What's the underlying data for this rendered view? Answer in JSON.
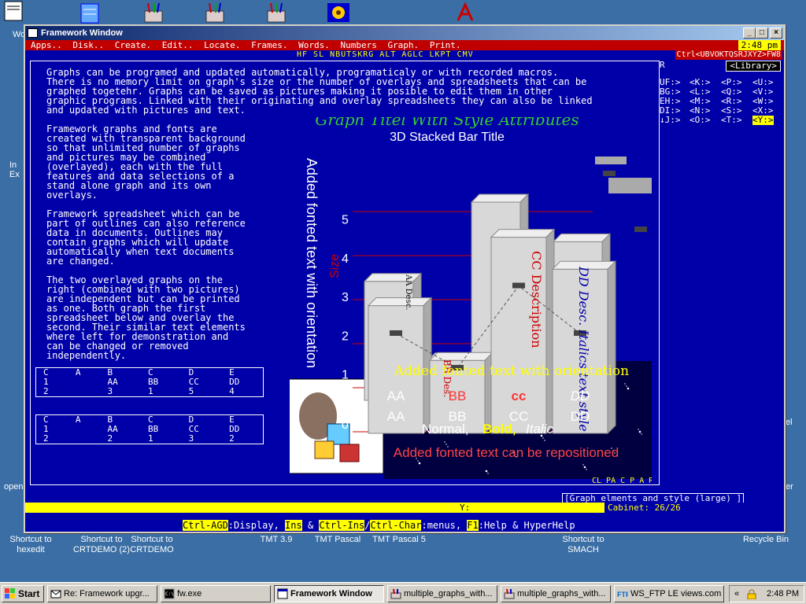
{
  "desktop": {
    "top_labels": [
      "Wo",
      "In Ex",
      "open",
      "el",
      "er"
    ],
    "icons": [
      {
        "label": "Shortcut to hexedit"
      },
      {
        "label": "Shortcut to CRTDEMO (2)"
      },
      {
        "label": "Shortcut to CRTDEMO"
      },
      {
        "label": "TMT 3.9"
      },
      {
        "label": "TMT Pascal"
      },
      {
        "label": "TMT Pascal 5"
      },
      {
        "label": "Shortcut to SMACH"
      },
      {
        "label": "Recycle Bin"
      }
    ]
  },
  "window": {
    "title": "Framework Window",
    "minimize": "_",
    "maximize": "□",
    "close": "×"
  },
  "menu": {
    "items": [
      "Apps..",
      "Disk..",
      "Create.",
      "Edit..",
      "Locate.",
      "Frames.",
      "Words.",
      "Numbers",
      "Graph.",
      "Print."
    ],
    "clock": "2:48 pm",
    "hotkeys": "HF SL NBUTSKRG ALT AGLC LKPT CMV",
    "ctrl_hint": "Ctrl<UBVOKTQSRJXYZ>FW8"
  },
  "document": {
    "para1": "Graphs can be programed and updated automatically, programaticaly or with recorded macros.\nThere is no memory limit on graph's size or the number of overlays and spreadsheets that can be\ngraphed togetehr. Graphs can be saved as pictures making it posible to edit them in other\ngraphic programs. Linked with their originating and overlay spreadsheets they can also be linked\nand updated with pictures and text.",
    "para2": "Framework graphs and fonts are\ncreated with transparent background\nso that unlimited number of graphs\nand pictures may be combined\n(overlayed), each with the full\nfeatures and data selections of a\nstand alone graph and its own\noverlays.",
    "para3": "Framework spreadsheet which can be\npart of outlines can also reference\ndata in documents. Outlines may\ncontain graphs which will update\nautomatically when text documents\nare changed.",
    "para4": "The two overlayed graphs on the\nright (combined with two pictures)\nare independent but can be printed\nas one. Both graph the first\nspreadsheet below and overlay the\nsecond. Their similar text elements\nwhere left for demonstration and\ncan be changed or removed\nindependently."
  },
  "spreadsheet1": {
    "header": [
      "C",
      "A",
      "B",
      "C",
      "D",
      "E"
    ],
    "rows": [
      [
        "1",
        "",
        "AA",
        "BB",
        "CC",
        "DD"
      ],
      [
        "2",
        "",
        "3",
        "1",
        "5",
        "4"
      ]
    ]
  },
  "spreadsheet2": {
    "header": [
      "C",
      "A",
      "B",
      "C",
      "D",
      "E"
    ],
    "rows": [
      [
        "1",
        "",
        "AA",
        "BB",
        "CC",
        "DD"
      ],
      [
        "2",
        "",
        "2",
        "1",
        "3",
        "2"
      ]
    ]
  },
  "side_panel": {
    "library": "<Library>",
    "r_label": "R",
    "keys": [
      {
        "text": "UF:>"
      },
      {
        "text": "<K:>"
      },
      {
        "text": "<P:>"
      },
      {
        "text": "<U:>"
      },
      {
        "text": "BG:>"
      },
      {
        "text": "<L:>"
      },
      {
        "text": "<Q:>"
      },
      {
        "text": "<V:>"
      },
      {
        "text": "EH:>"
      },
      {
        "text": "<M:>"
      },
      {
        "text": "<R:>"
      },
      {
        "text": "<W:>"
      },
      {
        "text": "DI:>"
      },
      {
        "text": "<N:>"
      },
      {
        "text": "<S:>"
      },
      {
        "text": "<X:>"
      },
      {
        "text": "↓J:>"
      },
      {
        "text": "<O:>"
      },
      {
        "text": "<T:>"
      },
      {
        "text": "<Y:>"
      }
    ]
  },
  "graph": {
    "styled_title": "Graph Titel With Style Attributes",
    "title": "3D Stacked Bar Title",
    "vertical_text": "Added fonted text with orientation",
    "ylabel": "Size",
    "overlay_text": "Added fonted text with orientation",
    "font_demo_normal": "Normal,",
    "font_demo_bold": "Bold,",
    "font_demo_italic": "Italic",
    "reposition_text": "Added fonted text can be repositioned",
    "bar_desc": [
      "AA Desc.",
      "BB Des.",
      "CC Description",
      "DD Desc. Italics text style"
    ],
    "cat_labels_front": [
      "AA",
      "BB",
      "cc",
      "DD"
    ],
    "cat_labels_back": [
      "AA",
      "BB",
      "CC",
      "DD"
    ],
    "y_ticks": [
      "0",
      "1",
      "2",
      "3",
      "4",
      "5"
    ],
    "mini_strip": "CL PA C P A R"
  },
  "chart_data": {
    "type": "bar",
    "title": "3D Stacked Bar Title",
    "categories": [
      "AA",
      "BB",
      "CC",
      "DD"
    ],
    "series": [
      {
        "values": [
          3,
          1,
          5,
          4
        ]
      },
      {
        "values": [
          2,
          1,
          3,
          2
        ]
      }
    ],
    "ylabel": "Size",
    "ylim": [
      0,
      5
    ],
    "line_overlay": [
      1,
      0.2,
      2.1,
      1
    ]
  },
  "status": {
    "y_label": "Y:",
    "cabinet": "Cabinet: 26/26",
    "graph_style": "[Graph elments and style (large) ]"
  },
  "help": {
    "k1": "Ctrl-AGD",
    "t1": ":Display, ",
    "k2": "Ins",
    "t2": " & ",
    "k3": "Ctrl-Ins",
    "t3": "/",
    "k4": "Ctrl-Char",
    "t4": ":menus, ",
    "k5": "F1",
    "t5": ":Help & HyperHelp"
  },
  "taskbar": {
    "start": "Start",
    "buttons": [
      "Re: Framework upgr...",
      "fw.exe",
      "Framework Window",
      "multiple_graphs_with...",
      "multiple_graphs_with...",
      "WS_FTP LE views.com"
    ],
    "active_index": 2,
    "tray_chevron": "«",
    "time": "2:48 PM"
  }
}
